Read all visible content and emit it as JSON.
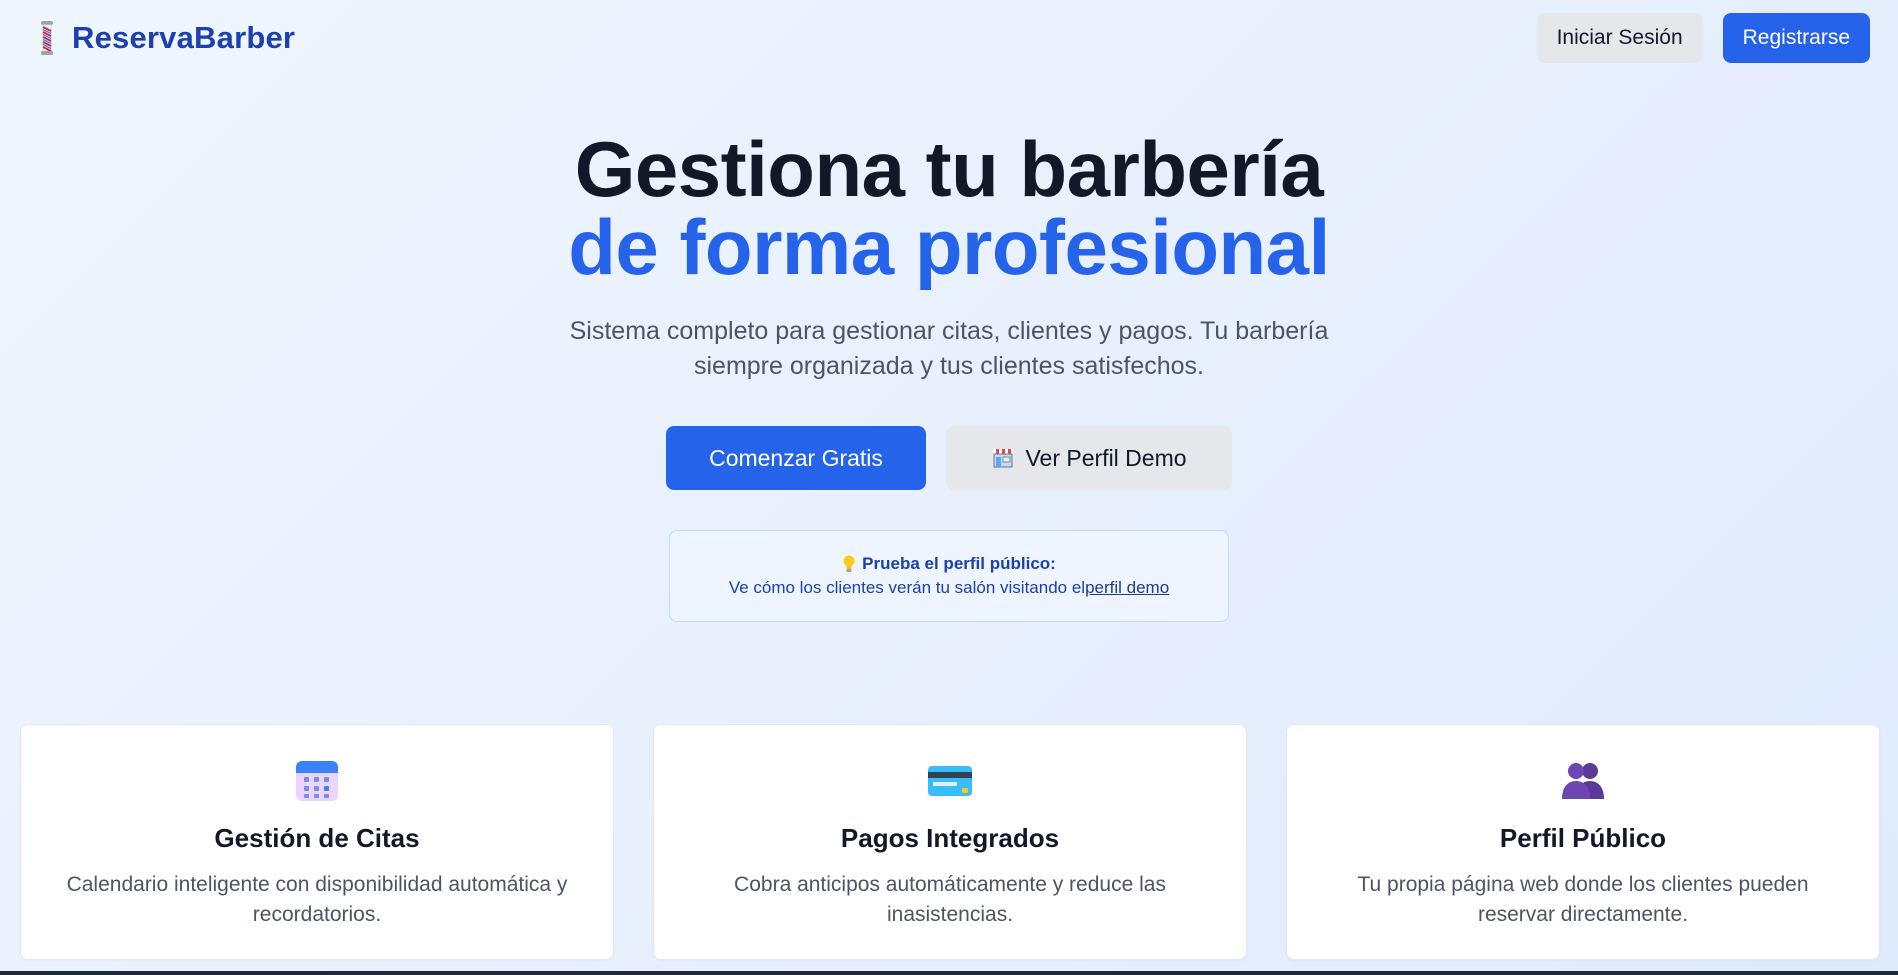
{
  "header": {
    "brand_name": "ReservaBarber",
    "brand_icon": "barber-pole-icon",
    "login_label": "Iniciar Sesión",
    "register_label": "Registrarse"
  },
  "hero": {
    "title_line_1": "Gestiona tu barbería",
    "title_line_2": "de forma profesional",
    "subtitle": "Sistema completo para gestionar citas, clientes y pagos. Tu barbería siempre organizada y tus clientes satisfechos.",
    "primary_cta": "Comenzar Gratis",
    "secondary_cta": "Ver Perfil Demo",
    "secondary_cta_icon": "store-icon"
  },
  "tip": {
    "icon": "lightbulb-icon",
    "title": "Prueba el perfil público:",
    "text": "Ve cómo los clientes verán tu salón visitando el",
    "link_text": "perfil demo"
  },
  "features": [
    {
      "icon": "calendar-icon",
      "title": "Gestión de Citas",
      "description": "Calendario inteligente con disponibilidad automática y recordatorios."
    },
    {
      "icon": "credit-card-icon",
      "title": "Pagos Integrados",
      "description": "Cobra anticipos automáticamente y reduce las inasistencias."
    },
    {
      "icon": "users-icon",
      "title": "Perfil Público",
      "description": "Tu propia página web donde los clientes pueden reservar directamente."
    }
  ],
  "colors": {
    "primary": "#2563eb",
    "brand_text": "#1e40af",
    "heading": "#111827",
    "body_text": "#4b5563",
    "secondary_button": "#e5e7eb"
  }
}
